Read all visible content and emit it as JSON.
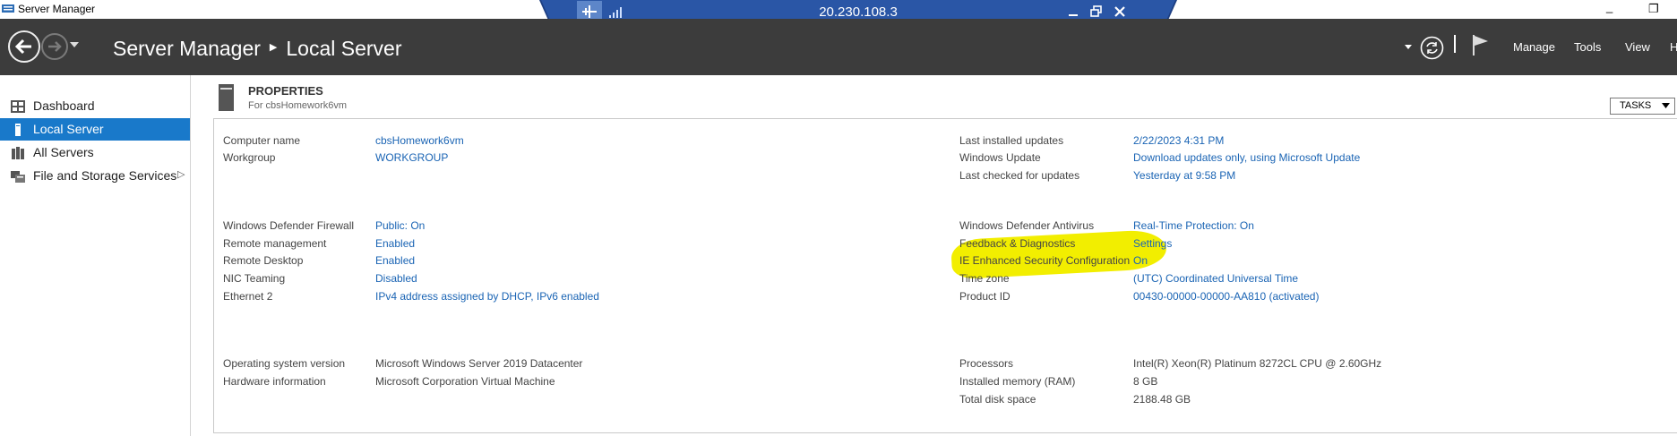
{
  "titlebar": {
    "title": "Server Manager",
    "maximize_glyph": "□",
    "restore_glyph": "❐"
  },
  "rdp": {
    "ip": "20.230.108.3",
    "icons": [
      "pin-icon",
      "signal-icon",
      "minimize-icon",
      "restore-icon",
      "close-icon"
    ]
  },
  "header": {
    "crumb_root": "Server Manager",
    "crumb_sep": "▶",
    "crumb_current": "Local Server",
    "menu": [
      "Manage",
      "Tools",
      "View",
      "H"
    ],
    "icons": [
      "back-icon",
      "forward-icon",
      "dropdown-icon",
      "refresh-icon",
      "flag-icon"
    ]
  },
  "sidebar": {
    "items": [
      {
        "label": "Dashboard",
        "icon": "dashboard-icon"
      },
      {
        "label": "Local Server",
        "icon": "server-icon",
        "active": true
      },
      {
        "label": "All Servers",
        "icon": "servers-icon"
      },
      {
        "label": "File and Storage Services",
        "icon": "storage-icon",
        "expand": "▷"
      }
    ]
  },
  "properties": {
    "title": "PROPERTIES",
    "subtitle": "For cbsHomework6vm",
    "tasks_label": "TASKS",
    "left_groups": [
      [
        {
          "key": "Computer name",
          "value": "cbsHomework6vm"
        },
        {
          "key": "Workgroup",
          "value": "WORKGROUP"
        }
      ],
      [
        {
          "key": "Windows Defender Firewall",
          "value": "Public: On"
        },
        {
          "key": "Remote management",
          "value": "Enabled"
        },
        {
          "key": "Remote Desktop",
          "value": "Enabled"
        },
        {
          "key": "NIC Teaming",
          "value": "Disabled"
        },
        {
          "key": "Ethernet 2",
          "value": "IPv4 address assigned by DHCP, IPv6 enabled"
        }
      ],
      [
        {
          "key": "Operating system version",
          "value": "Microsoft Windows Server 2019 Datacenter"
        },
        {
          "key": "Hardware information",
          "value": "Microsoft Corporation Virtual Machine"
        }
      ]
    ],
    "right_groups": [
      [
        {
          "key": "Last installed updates",
          "value": "2/22/2023 4:31 PM"
        },
        {
          "key": "Windows Update",
          "value": "Download updates only, using Microsoft Update"
        },
        {
          "key": "Last checked for updates",
          "value": "Yesterday at 9:58 PM"
        }
      ],
      [
        {
          "key": "Windows Defender Antivirus",
          "value": "Real-Time Protection: On"
        },
        {
          "key": "Feedback & Diagnostics",
          "value": "Settings"
        },
        {
          "key": "IE Enhanced Security Configuration",
          "value": "On"
        },
        {
          "key": "Time zone",
          "value": "(UTC) Coordinated Universal Time"
        },
        {
          "key": "Product ID",
          "value": "00430-00000-00000-AA810 (activated)"
        }
      ],
      [
        {
          "key": "Processors",
          "value": "Intel(R) Xeon(R) Platinum 8272CL CPU @ 2.60GHz"
        },
        {
          "key": "Installed memory (RAM)",
          "value": "8 GB"
        },
        {
          "key": "Total disk space",
          "value": "2188.48 GB"
        }
      ]
    ]
  },
  "colors": {
    "header_bg": "#3c3c3c",
    "active_item": "#1979ca",
    "link": "#1a64b4",
    "highlight": "#f2ee00",
    "rdp_bar": "#1d3f82"
  }
}
